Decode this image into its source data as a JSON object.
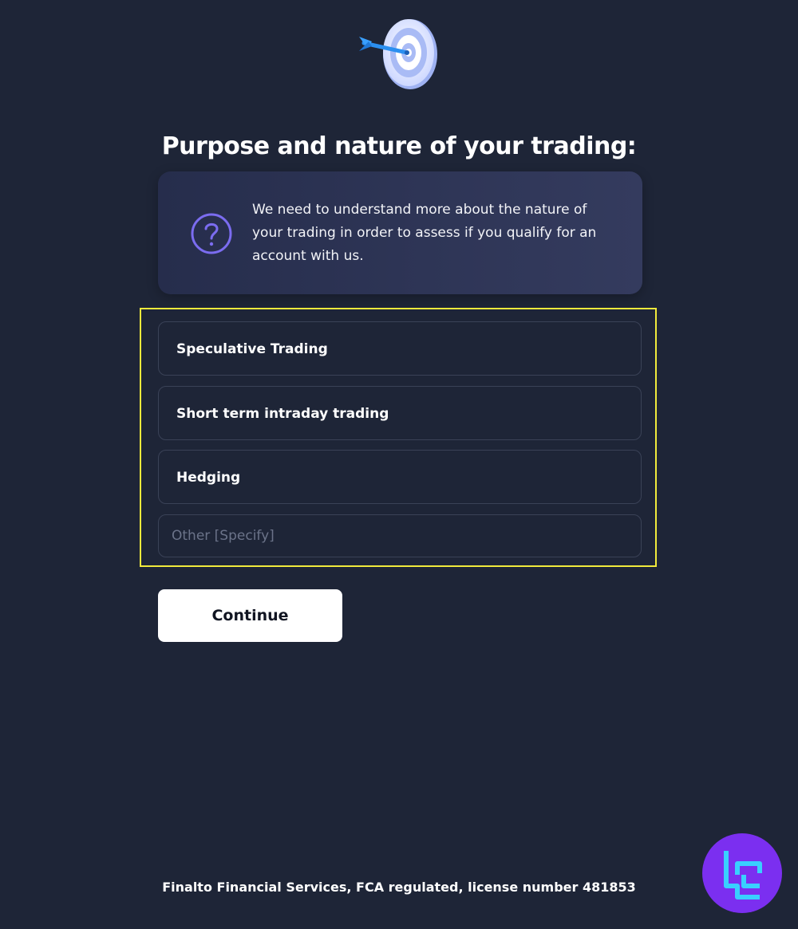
{
  "title": "Purpose and nature of your trading:",
  "info": {
    "text": "We need to understand more about the nature of your trading in order to assess if you qualify for an account with us.",
    "icon": "question-circle-icon"
  },
  "hero_icon": "dart-target-icon",
  "options": [
    {
      "label": "Speculative Trading"
    },
    {
      "label": "Short term intraday trading"
    },
    {
      "label": "Hedging"
    }
  ],
  "other": {
    "value": "",
    "placeholder": "Other [Specify]"
  },
  "continue_label": "Continue",
  "footer": "Finalto Financial Services, FCA regulated, license number 481853",
  "badge_icon": "tc-logo-badge-icon",
  "colors": {
    "background": "#1e2537",
    "card": "#2e3556",
    "accent": "#7b6cf0",
    "highlight": "#f1ea3c",
    "button": "#ffffff",
    "badge": "#7b2ff0"
  }
}
